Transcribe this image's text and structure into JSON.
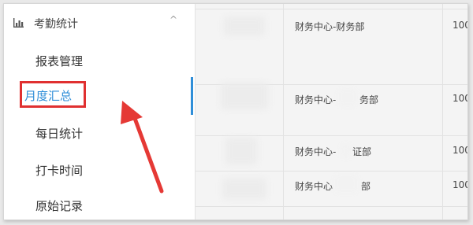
{
  "sidebar": {
    "title": "考勤统计",
    "caret": "^",
    "items": [
      {
        "label": "报表管理"
      },
      {
        "label": "月度汇总"
      },
      {
        "label": "每日统计"
      },
      {
        "label": "打卡时间"
      },
      {
        "label": "原始记录"
      }
    ]
  },
  "table": {
    "rows": [
      {
        "department": "财务中心-财务部",
        "value": "100"
      },
      {
        "department": "财务中心-",
        "department_tail": "务部",
        "value": "100"
      },
      {
        "department": "财务中心-",
        "department_tail": "证部",
        "value": "100"
      },
      {
        "department": "财务中心",
        "department_tail": "部",
        "value": "100"
      }
    ]
  },
  "colors": {
    "accent": "#2f8ed8",
    "highlight_border": "#e03030",
    "annotation_arrow": "#e53935"
  },
  "icons": {
    "sidebar_header": "bar-chart-icon",
    "collapse": "caret-up-icon",
    "annotation": "red-arrow-annotation"
  }
}
